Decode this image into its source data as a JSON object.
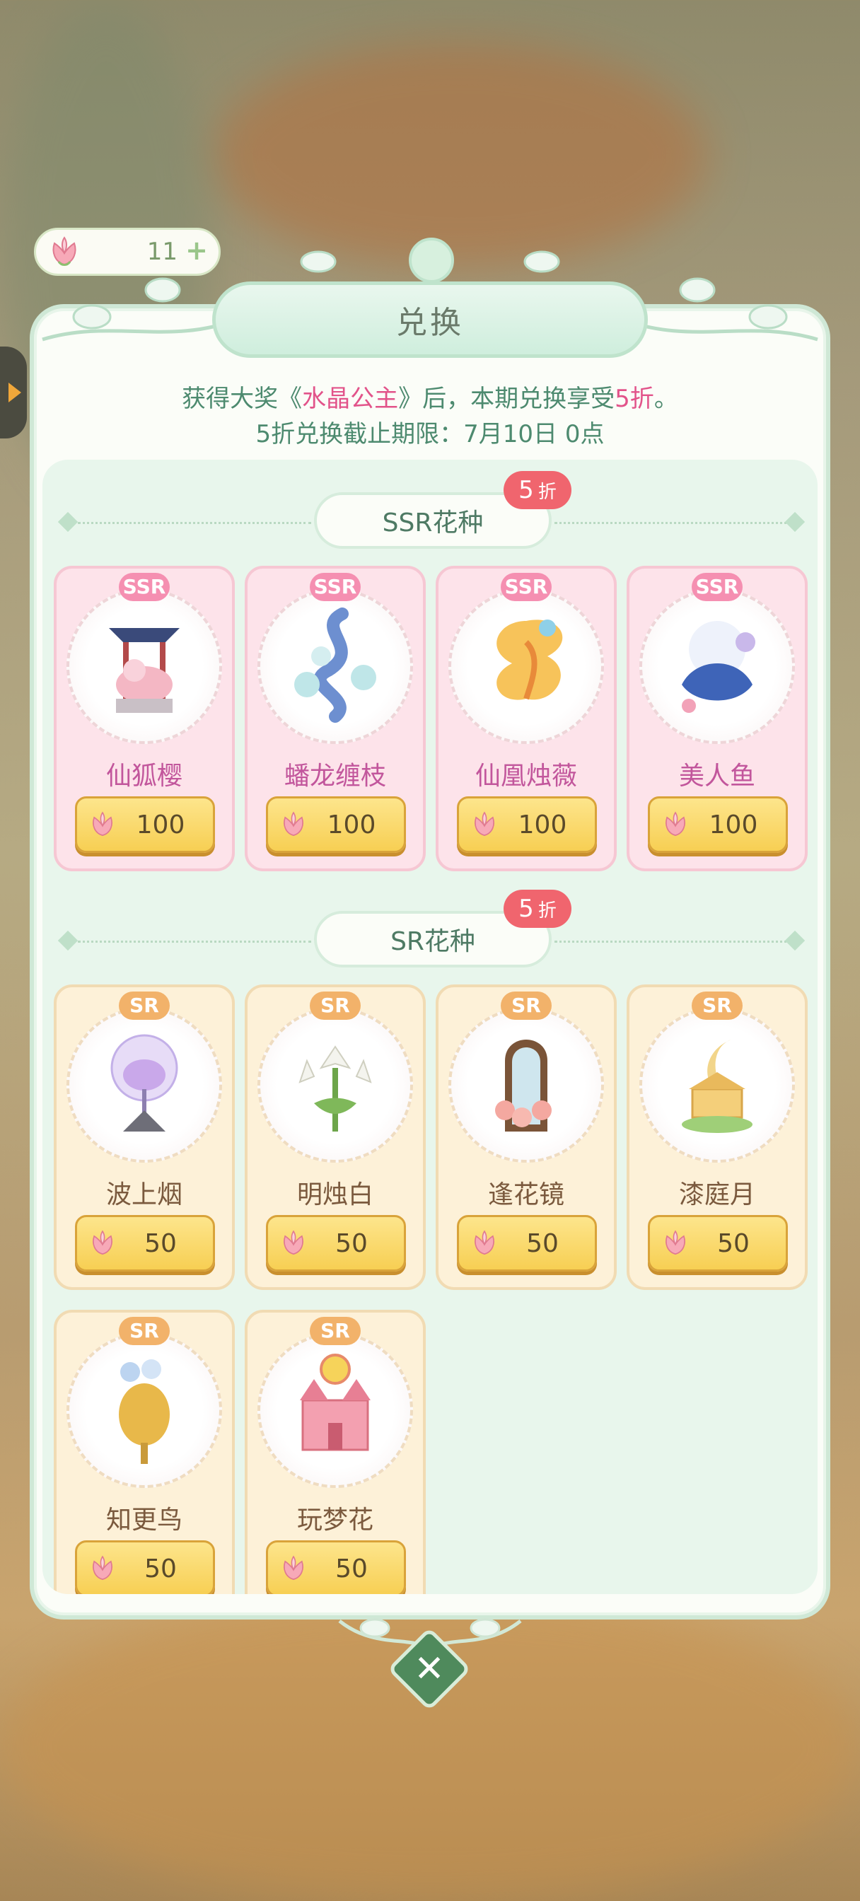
{
  "currency": {
    "amount": "11"
  },
  "dialog": {
    "title": "兑换"
  },
  "notice": {
    "line1_prefix": "获得大奖《",
    "line1_highlight": "水晶公主",
    "line1_mid": "》后，本期兑换享受",
    "line1_discount": "5折",
    "line1_suffix": "。",
    "line2": "5折兑换截止期限：7月10日 0点"
  },
  "sections": [
    {
      "title": "SSR花种",
      "badge_num": "5",
      "badge_unit": "折",
      "items": [
        {
          "rarity": "SSR",
          "name": "仙狐樱",
          "price": "100"
        },
        {
          "rarity": "SSR",
          "name": "蟠龙缠枝",
          "price": "100"
        },
        {
          "rarity": "SSR",
          "name": "仙凰烛薇",
          "price": "100"
        },
        {
          "rarity": "SSR",
          "name": "美人鱼",
          "price": "100"
        }
      ]
    },
    {
      "title": "SR花种",
      "badge_num": "5",
      "badge_unit": "折",
      "items": [
        {
          "rarity": "SR",
          "name": "波上烟",
          "price": "50"
        },
        {
          "rarity": "SR",
          "name": "明烛白",
          "price": "50"
        },
        {
          "rarity": "SR",
          "name": "逢花镜",
          "price": "50"
        },
        {
          "rarity": "SR",
          "name": "漆庭月",
          "price": "50"
        },
        {
          "rarity": "SR",
          "name": "知更鸟",
          "price": "50"
        },
        {
          "rarity": "SR",
          "name": "玩梦花",
          "price": "50"
        }
      ]
    }
  ],
  "icons": {
    "currency": "pink-flower-bud-icon",
    "plus": "plus-icon",
    "close": "close-icon",
    "side": "expand-arrow-icon"
  },
  "colors": {
    "panel_border": "#cfe8d6",
    "ssr_card": "#fde3ea",
    "sr_card": "#fdf1d8",
    "price_button": "#f7cf53",
    "discount_badge": "#f0656e",
    "highlight_text": "#e2538a"
  }
}
